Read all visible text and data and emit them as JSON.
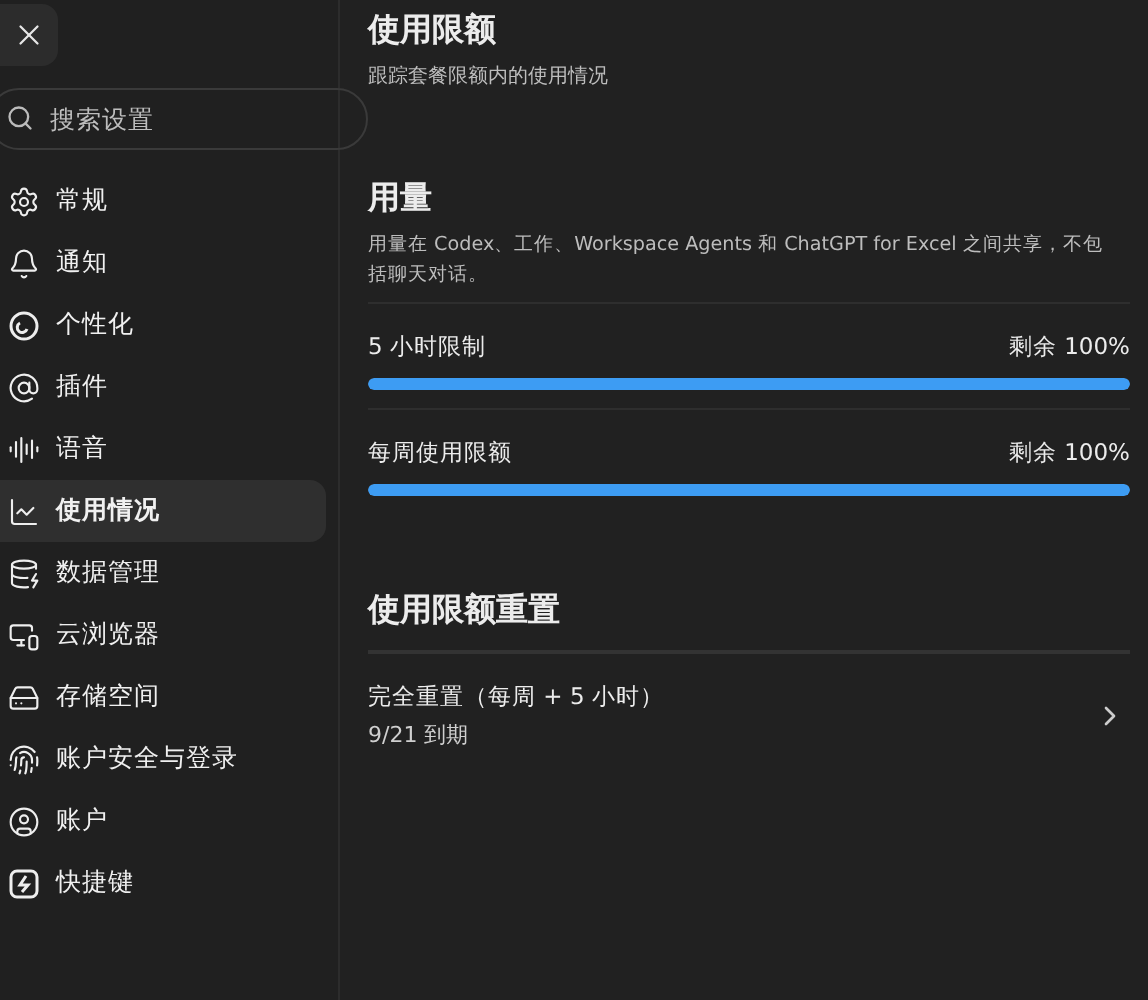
{
  "search": {
    "placeholder": "搜索设置"
  },
  "sidebar": {
    "items": [
      {
        "label": "常规",
        "selected": false
      },
      {
        "label": "通知",
        "selected": false
      },
      {
        "label": "个性化",
        "selected": false
      },
      {
        "label": "插件",
        "selected": false
      },
      {
        "label": "语音",
        "selected": false
      },
      {
        "label": "使用情况",
        "selected": true
      },
      {
        "label": "数据管理",
        "selected": false
      },
      {
        "label": "云浏览器",
        "selected": false
      },
      {
        "label": "存储空间",
        "selected": false
      },
      {
        "label": "账户安全与登录",
        "selected": false
      },
      {
        "label": "账户",
        "selected": false
      },
      {
        "label": "快捷键",
        "selected": false
      }
    ]
  },
  "header": {
    "title": "使用限额",
    "subtitle": "跟踪套餐限额内的使用情况"
  },
  "usage": {
    "title": "用量",
    "description": "用量在 Codex、工作、Workspace Agents 和 ChatGPT for Excel 之间共享，不包括聊天对话。",
    "limits": [
      {
        "name": "5 小时限制",
        "reading": "剩余 100%",
        "level": 1
      },
      {
        "name": "每周使用限额",
        "reading": "剩余 100%",
        "level": 1
      }
    ]
  },
  "resets": {
    "title": "使用限额重置",
    "items": [
      {
        "title": "完全重置（每周 + 5 小时）",
        "subtitle": "9/21 到期"
      }
    ]
  }
}
